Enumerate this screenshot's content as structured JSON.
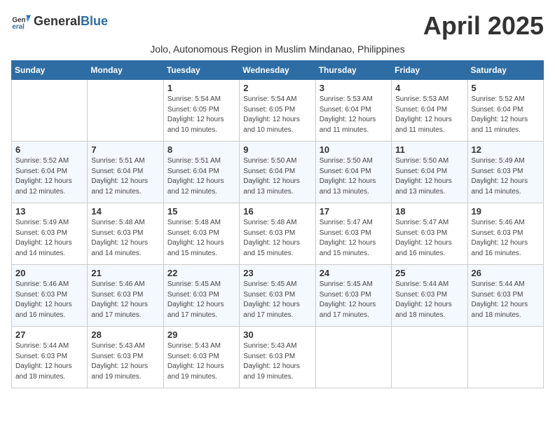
{
  "header": {
    "logo_general": "General",
    "logo_blue": "Blue",
    "month_title": "April 2025",
    "subtitle": "Jolo, Autonomous Region in Muslim Mindanao, Philippines"
  },
  "weekdays": [
    "Sunday",
    "Monday",
    "Tuesday",
    "Wednesday",
    "Thursday",
    "Friday",
    "Saturday"
  ],
  "weeks": [
    [
      {
        "day": "",
        "details": ""
      },
      {
        "day": "",
        "details": ""
      },
      {
        "day": "1",
        "details": "Sunrise: 5:54 AM\nSunset: 6:05 PM\nDaylight: 12 hours and 10 minutes."
      },
      {
        "day": "2",
        "details": "Sunrise: 5:54 AM\nSunset: 6:05 PM\nDaylight: 12 hours and 10 minutes."
      },
      {
        "day": "3",
        "details": "Sunrise: 5:53 AM\nSunset: 6:04 PM\nDaylight: 12 hours and 11 minutes."
      },
      {
        "day": "4",
        "details": "Sunrise: 5:53 AM\nSunset: 6:04 PM\nDaylight: 12 hours and 11 minutes."
      },
      {
        "day": "5",
        "details": "Sunrise: 5:52 AM\nSunset: 6:04 PM\nDaylight: 12 hours and 11 minutes."
      }
    ],
    [
      {
        "day": "6",
        "details": "Sunrise: 5:52 AM\nSunset: 6:04 PM\nDaylight: 12 hours and 12 minutes."
      },
      {
        "day": "7",
        "details": "Sunrise: 5:51 AM\nSunset: 6:04 PM\nDaylight: 12 hours and 12 minutes."
      },
      {
        "day": "8",
        "details": "Sunrise: 5:51 AM\nSunset: 6:04 PM\nDaylight: 12 hours and 12 minutes."
      },
      {
        "day": "9",
        "details": "Sunrise: 5:50 AM\nSunset: 6:04 PM\nDaylight: 12 hours and 13 minutes."
      },
      {
        "day": "10",
        "details": "Sunrise: 5:50 AM\nSunset: 6:04 PM\nDaylight: 12 hours and 13 minutes."
      },
      {
        "day": "11",
        "details": "Sunrise: 5:50 AM\nSunset: 6:04 PM\nDaylight: 12 hours and 13 minutes."
      },
      {
        "day": "12",
        "details": "Sunrise: 5:49 AM\nSunset: 6:03 PM\nDaylight: 12 hours and 14 minutes."
      }
    ],
    [
      {
        "day": "13",
        "details": "Sunrise: 5:49 AM\nSunset: 6:03 PM\nDaylight: 12 hours and 14 minutes."
      },
      {
        "day": "14",
        "details": "Sunrise: 5:48 AM\nSunset: 6:03 PM\nDaylight: 12 hours and 14 minutes."
      },
      {
        "day": "15",
        "details": "Sunrise: 5:48 AM\nSunset: 6:03 PM\nDaylight: 12 hours and 15 minutes."
      },
      {
        "day": "16",
        "details": "Sunrise: 5:48 AM\nSunset: 6:03 PM\nDaylight: 12 hours and 15 minutes."
      },
      {
        "day": "17",
        "details": "Sunrise: 5:47 AM\nSunset: 6:03 PM\nDaylight: 12 hours and 15 minutes."
      },
      {
        "day": "18",
        "details": "Sunrise: 5:47 AM\nSunset: 6:03 PM\nDaylight: 12 hours and 16 minutes."
      },
      {
        "day": "19",
        "details": "Sunrise: 5:46 AM\nSunset: 6:03 PM\nDaylight: 12 hours and 16 minutes."
      }
    ],
    [
      {
        "day": "20",
        "details": "Sunrise: 5:46 AM\nSunset: 6:03 PM\nDaylight: 12 hours and 16 minutes."
      },
      {
        "day": "21",
        "details": "Sunrise: 5:46 AM\nSunset: 6:03 PM\nDaylight: 12 hours and 17 minutes."
      },
      {
        "day": "22",
        "details": "Sunrise: 5:45 AM\nSunset: 6:03 PM\nDaylight: 12 hours and 17 minutes."
      },
      {
        "day": "23",
        "details": "Sunrise: 5:45 AM\nSunset: 6:03 PM\nDaylight: 12 hours and 17 minutes."
      },
      {
        "day": "24",
        "details": "Sunrise: 5:45 AM\nSunset: 6:03 PM\nDaylight: 12 hours and 17 minutes."
      },
      {
        "day": "25",
        "details": "Sunrise: 5:44 AM\nSunset: 6:03 PM\nDaylight: 12 hours and 18 minutes."
      },
      {
        "day": "26",
        "details": "Sunrise: 5:44 AM\nSunset: 6:03 PM\nDaylight: 12 hours and 18 minutes."
      }
    ],
    [
      {
        "day": "27",
        "details": "Sunrise: 5:44 AM\nSunset: 6:03 PM\nDaylight: 12 hours and 18 minutes."
      },
      {
        "day": "28",
        "details": "Sunrise: 5:43 AM\nSunset: 6:03 PM\nDaylight: 12 hours and 19 minutes."
      },
      {
        "day": "29",
        "details": "Sunrise: 5:43 AM\nSunset: 6:03 PM\nDaylight: 12 hours and 19 minutes."
      },
      {
        "day": "30",
        "details": "Sunrise: 5:43 AM\nSunset: 6:03 PM\nDaylight: 12 hours and 19 minutes."
      },
      {
        "day": "",
        "details": ""
      },
      {
        "day": "",
        "details": ""
      },
      {
        "day": "",
        "details": ""
      }
    ]
  ]
}
